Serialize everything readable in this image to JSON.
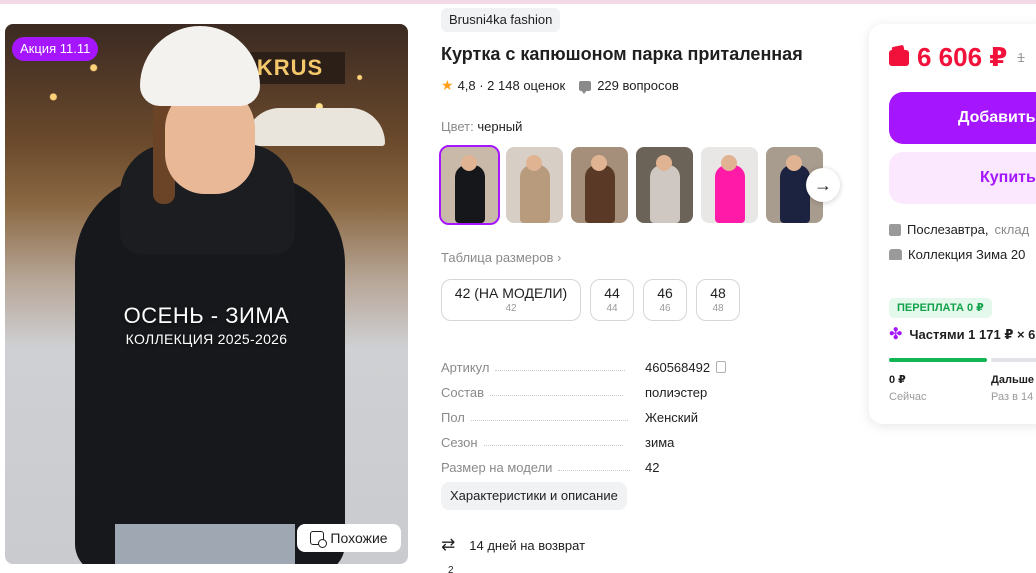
{
  "promo": {
    "badge": "Акция 11.11"
  },
  "photo": {
    "sign_text": "KRUS",
    "overlay_title": "ОСЕНЬ - ЗИМА",
    "overlay_subtitle": "КОЛЛЕКЦИЯ 2025-2026",
    "similar_label": "Похожие"
  },
  "product": {
    "brand": "Brusni4ka fashion",
    "title": "Куртка с капюшоном парка приталенная",
    "rating": "4,8 · 2 148 оценок",
    "questions": "229 вопросов",
    "color_label": "Цвет:",
    "color_value": "черный"
  },
  "thumbnails": [
    {
      "color": "#15171a",
      "bg": "#c9b9a8",
      "active": true
    },
    {
      "color": "#b89a7c",
      "bg": "#d7cfc6",
      "active": false
    },
    {
      "color": "#5a3a26",
      "bg": "#a58f7a",
      "active": false
    },
    {
      "color": "#cfc8c2",
      "bg": "#6b6258",
      "active": false
    },
    {
      "color": "#ff1aa8",
      "bg": "#e9e7e6",
      "active": false
    },
    {
      "color": "#1c2340",
      "bg": "#a89c8e",
      "active": false
    }
  ],
  "sizes": {
    "table_link": "Таблица размеров ›",
    "items": [
      {
        "main": "42 (НА МОДЕЛИ)",
        "sub": "42"
      },
      {
        "main": "44",
        "sub": "44"
      },
      {
        "main": "46",
        "sub": "46"
      },
      {
        "main": "48",
        "sub": "48"
      }
    ]
  },
  "specs": [
    {
      "key": "Артикул",
      "value": "460568492"
    },
    {
      "key": "Состав",
      "value": "полиэстер"
    },
    {
      "key": "Пол",
      "value": "Женский"
    },
    {
      "key": "Сезон",
      "value": "зима"
    },
    {
      "key": "Размер на модели",
      "value": "42"
    }
  ],
  "details_button": "Характеристики и описание",
  "return_policy": "14 дней на возврат",
  "cut_row": "2",
  "buy": {
    "price": "6 606 ₽",
    "old_price": "1",
    "add_button": "Добавить",
    "buy_button": "Купить",
    "delivery": "Послезавтра,",
    "delivery_muted": "склад",
    "collection": "Коллекция Зима 20",
    "overpay_badge": "ПЕРЕПЛАТА 0 ₽",
    "installment": "Частями 1 171 ₽ × 6",
    "step_now_amount": "0 ₽",
    "step_now_label": "Сейчас",
    "step_next_title": "Дальше",
    "step_next_label": "Раз в 14"
  },
  "colors": {
    "accent": "#a516ff",
    "price": "#f1113a",
    "success": "#12b554"
  },
  "icons": [
    "star-icon",
    "question-icon",
    "chevron-right-icon",
    "copy-icon",
    "return-icon",
    "wallet-icon",
    "box-icon",
    "store-icon",
    "plus-icon",
    "similar-icon"
  ]
}
